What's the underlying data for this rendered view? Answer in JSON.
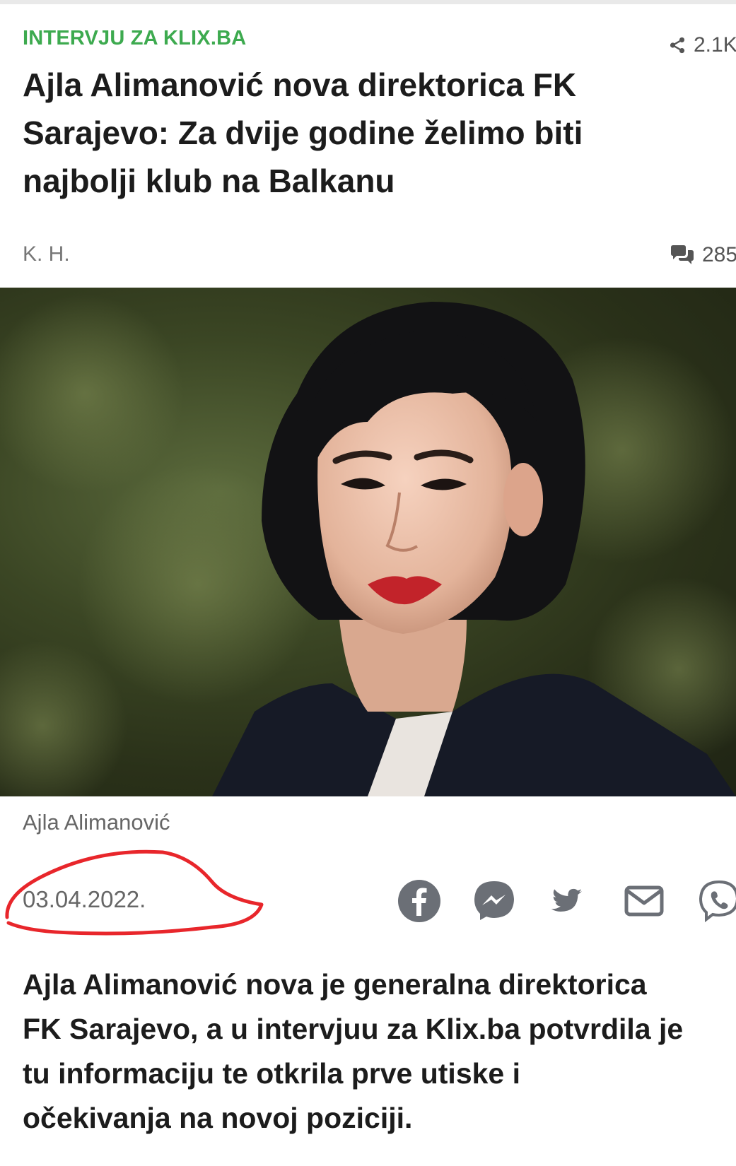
{
  "article": {
    "category": "INTERVJU ZA KLIX.BA",
    "share_count": "2.1K",
    "headline_lines": [
      "Ajla Alimanović nova direktorica FK",
      "Sarajevo: Za dvije godine želimo biti",
      "najbolji klub na Balkanu"
    ],
    "author": "K. H.",
    "comment_count": "285",
    "photo_caption": "Ajla Alimanović",
    "date": "03.04.2022.",
    "lead_lines": [
      "Ajla Alimanović nova je generalna direktorica",
      "FK Sarajevo, a u intervjuu za Klix.ba potvrdila je",
      "tu informaciju te otkrila prve utiske i",
      "očekivanja na novoj poziciji."
    ]
  },
  "share_buttons": [
    {
      "icon": "facebook-icon"
    },
    {
      "icon": "messenger-icon"
    },
    {
      "icon": "twitter-icon"
    },
    {
      "icon": "email-icon"
    },
    {
      "icon": "viber-icon"
    }
  ],
  "colors": {
    "category": "#3daa4f",
    "text": "#1c1c1c",
    "muted": "#666666",
    "icon": "#6b6f76",
    "annotation": "#e8262b"
  }
}
